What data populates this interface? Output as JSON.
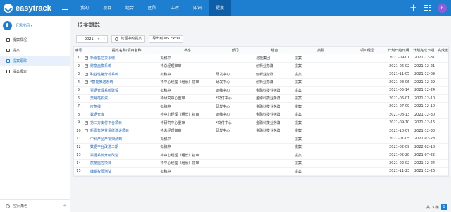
{
  "app": {
    "logo_text": "easytrack",
    "avatar_letter": "F"
  },
  "nav": [
    "我的",
    "项目",
    "组合",
    "团队",
    "工时",
    "知识",
    "提案"
  ],
  "sidebar": {
    "space_name": "汇思空间",
    "items": [
      {
        "label": "提案概况",
        "active": false
      },
      {
        "label": "提案",
        "active": false
      },
      {
        "label": "提案跟踪",
        "active": true
      },
      {
        "label": "提案报表",
        "active": false
      }
    ],
    "footer_label": "空间角色"
  },
  "main": {
    "page_title": "提案跟踪",
    "toolbar": {
      "year": "2021",
      "prev_label": "‹",
      "next_label": "›",
      "dropdown_caret": "▾",
      "search_button": "处理中的提案",
      "export_button": "导出到 MS Excel"
    },
    "table": {
      "headers": [
        "序号",
        "提案名称/项目名称",
        "状态",
        "部门",
        "组合",
        "类别",
        "项目经理",
        "计划开始日期",
        "计划完成日期",
        "完成度"
      ],
      "rows": [
        {
          "no": "1",
          "name": "新零售信贷系统",
          "expander": true,
          "status": "拟稿中",
          "dept": "",
          "group": "易能集团",
          "cat": "提案",
          "start": "2021-09-01",
          "end": "2021-12-31"
        },
        {
          "no": "2",
          "name": "财富画像系统",
          "expander": true,
          "status": "待总经理审审",
          "dept": "",
          "group": "创新业务群",
          "cat": "提案",
          "start": "2021-06-02",
          "end": "2021-12-21"
        },
        {
          "no": "3",
          "name": "职业性格分析系统",
          "expander": true,
          "status": "拟稿中",
          "dept": "研发中心",
          "group": "创新业务群",
          "cat": "提案",
          "start": "2021-11-05",
          "end": "2021-12-09"
        },
        {
          "no": "4",
          "name": "*智能推送系统",
          "expander": true,
          "status": "待中心经理（组长）初审",
          "dept": "研发中心",
          "group": "创新业务群",
          "cat": "提案",
          "start": "2021-08-06",
          "end": "2021-12-29"
        },
        {
          "no": "5",
          "name": "票据管理系统建设",
          "expander": false,
          "status": "拟稿中",
          "dept": "运维中心",
          "group": "金融科技业务群",
          "cat": "提案",
          "start": "2021-05-14",
          "end": "2021-12-24"
        },
        {
          "no": "6",
          "name": "交易站职资",
          "expander": false,
          "status": "待研究中心重审",
          "dept": "*交付中心",
          "group": "金融科技业务群",
          "cat": "提案",
          "start": "2021-06-01",
          "end": "2021-12-10"
        },
        {
          "no": "7",
          "name": "应急线",
          "expander": false,
          "status": "拟稿中",
          "dept": "研发中心",
          "group": "金融科技业务群",
          "cat": "提案",
          "start": "2021-07-09",
          "end": "2021-12-10"
        },
        {
          "no": "8",
          "name": "数据仓库",
          "expander": false,
          "status": "待中心经理（组长）初审",
          "dept": "运维中心",
          "group": "金融科技业务群",
          "cat": "提案",
          "start": "2021-08-13",
          "end": "2021-12-30"
        },
        {
          "no": "9",
          "name": "第三方支付平台项目",
          "expander": true,
          "status": "待研究中心重审",
          "dept": "*交付中心",
          "group": "金融科技业务群",
          "cat": "提案",
          "start": "2021-09-10",
          "end": "2021-12-16"
        },
        {
          "no": "10",
          "name": "新零售信贷系统建设项目",
          "expander": true,
          "status": "待总经理审审",
          "dept": "研发中心",
          "group": "金融科技业务群",
          "cat": "提案",
          "start": "2021-10-07",
          "end": "2021-12-30"
        },
        {
          "no": "11",
          "name": "中科产品产销归测到",
          "expander": false,
          "status": "拟稿中",
          "dept": "",
          "group": "",
          "cat": "提案",
          "start": "2021-01-05",
          "end": "2021-02-28"
        },
        {
          "no": "12",
          "name": "数据平台改造二期",
          "expander": false,
          "status": "拟稿中",
          "dept": "",
          "group": "",
          "cat": "提案",
          "start": "2021-02-09",
          "end": "2022-02-18"
        },
        {
          "no": "13",
          "name": "票据系统升级改造",
          "expander": false,
          "status": "待中心经理（组长）初审",
          "dept": "",
          "group": "",
          "cat": "提案",
          "start": "2021-02-28",
          "end": "2021-07-22"
        },
        {
          "no": "14",
          "name": "质量监控项目",
          "expander": false,
          "status": "待中心经理（组长）初审",
          "dept": "",
          "group": "",
          "cat": "提案",
          "start": "2021-02-02",
          "end": "2021-12-24"
        },
        {
          "no": "15",
          "name": "编辑权限测试",
          "expander": false,
          "status": "拟稿中",
          "dept": "",
          "group": "",
          "cat": "提案",
          "start": "2021-11-23",
          "end": "2021-12-26"
        }
      ]
    },
    "pager": {
      "total": "共15 条",
      "page": "1"
    }
  }
}
